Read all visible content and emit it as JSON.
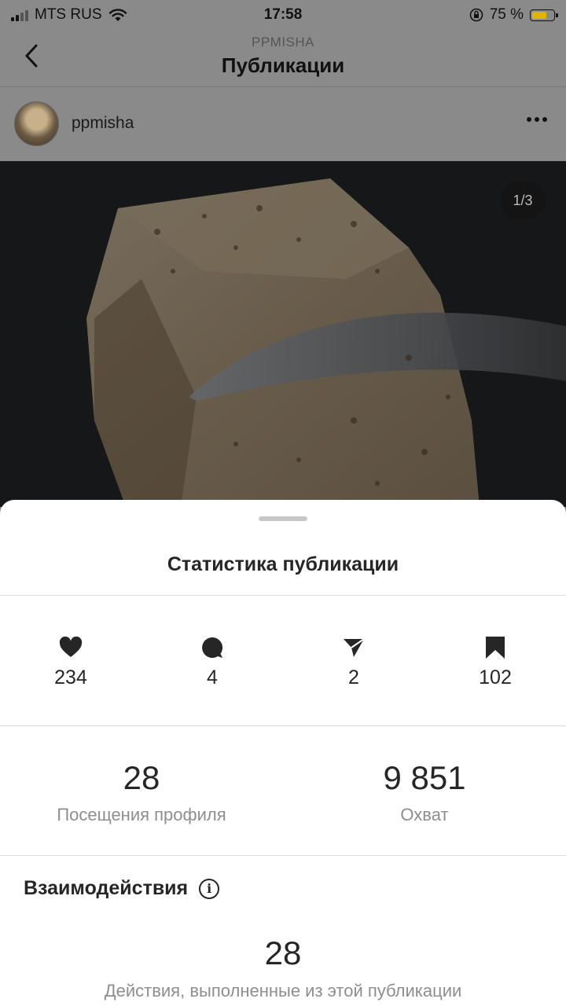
{
  "status_bar": {
    "carrier": "MTS RUS",
    "time": "17:58",
    "battery_percent": "75 %",
    "battery_level": 0.75
  },
  "nav": {
    "subtitle": "PPMISHA",
    "title": "Публикации"
  },
  "post": {
    "username": "ppmisha",
    "photo_counter": "1/3"
  },
  "sheet": {
    "title": "Статистика публикации",
    "stats": [
      {
        "icon": "heart-icon",
        "value": "234"
      },
      {
        "icon": "comment-icon",
        "value": "4"
      },
      {
        "icon": "share-icon",
        "value": "2"
      },
      {
        "icon": "bookmark-icon",
        "value": "102"
      }
    ],
    "profile_visits": {
      "value": "28",
      "label": "Посещения профиля"
    },
    "reach": {
      "value": "9 851",
      "label": "Охват"
    },
    "interactions": {
      "title": "Взаимодействия",
      "value": "28",
      "label": "Действия, выполненные из этой публикации"
    }
  },
  "colors": {
    "dim_overlay": "#8a8a8a",
    "sheet_bg": "#ffffff",
    "text_primary": "#262626",
    "text_secondary": "#8e8e8e",
    "battery": "#e0b400"
  }
}
